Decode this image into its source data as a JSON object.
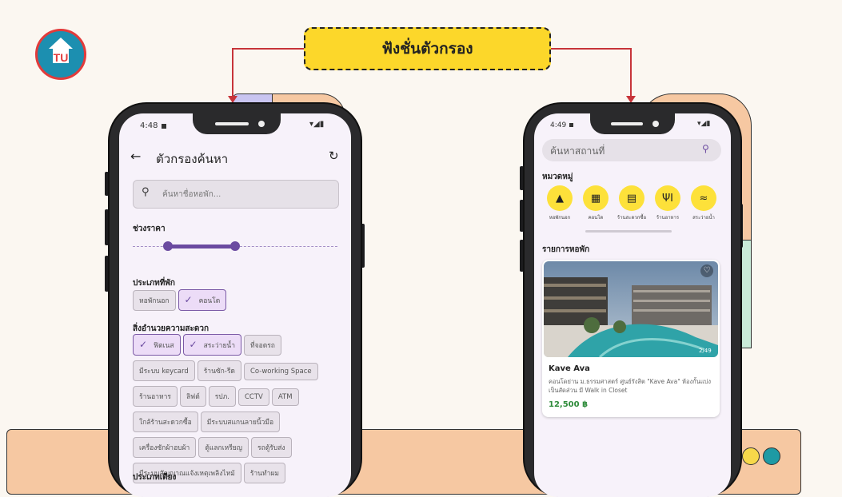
{
  "banner": {
    "title": "ฟังชั่นตัวกรอง"
  },
  "left_phone": {
    "status_time": "4:48",
    "header_title": "ตัวกรองค้นหา",
    "search_placeholder": "ค้นหาชื่อหอพัก...",
    "price_section": "ช่วงราคา",
    "type_section": "ประเภทที่พัก",
    "type_chips": [
      {
        "label": "หอพักนอก",
        "selected": false
      },
      {
        "label": "คอนโด",
        "selected": true
      }
    ],
    "amenity_section": "สิ่งอำนวยความสะดวก",
    "amenity_rows": [
      [
        {
          "label": "ฟิตเนส",
          "selected": true
        },
        {
          "label": "สระว่ายน้ำ",
          "selected": true
        },
        {
          "label": "ที่จอดรถ",
          "selected": false
        }
      ],
      [
        {
          "label": "มีระบบ keycard",
          "selected": false
        },
        {
          "label": "ร้านซัก-รีด",
          "selected": false
        },
        {
          "label": "Co-working Space",
          "selected": false
        }
      ],
      [
        {
          "label": "ร้านอาหาร",
          "selected": false
        },
        {
          "label": "ลิฟต์",
          "selected": false
        },
        {
          "label": "รปภ.",
          "selected": false
        },
        {
          "label": "CCTV",
          "selected": false
        },
        {
          "label": "ATM",
          "selected": false
        }
      ],
      [
        {
          "label": "ใกล้ร้านสะดวกซื้อ",
          "selected": false
        },
        {
          "label": "มีระบบสแกนลายนิ้วมือ",
          "selected": false
        }
      ],
      [
        {
          "label": "เครื่องซักผ้าอบผ้า",
          "selected": false
        },
        {
          "label": "ตู้แลกเหรียญ",
          "selected": false
        },
        {
          "label": "รถตู้รับส่ง",
          "selected": false
        }
      ],
      [
        {
          "label": "มีระบบสัญญาณแจ้งเหตุเพลิงไหม้",
          "selected": false
        },
        {
          "label": "ร้านทำผม",
          "selected": false
        }
      ]
    ],
    "bed_section": "ประเภทเตียง"
  },
  "right_phone": {
    "status_time": "4:49",
    "search_placeholder": "ค้นหาสถานที่",
    "category_section": "หมวดหมู่",
    "categories": [
      {
        "label": "หอพักนอก",
        "icon": "mountain-icon",
        "glyph": "▲"
      },
      {
        "label": "คอนโด",
        "icon": "building-icon",
        "glyph": "▦"
      },
      {
        "label": "ร้านสะดวกซื้อ",
        "icon": "store-icon",
        "glyph": "▤"
      },
      {
        "label": "ร้านอาหาร",
        "icon": "restaurant-icon",
        "glyph": "ΨΙ"
      },
      {
        "label": "สระว่ายน้ำ",
        "icon": "pool-icon",
        "glyph": "≈"
      }
    ],
    "list_section": "รายการหอพัก",
    "listing": {
      "photo_count": "2/49",
      "name": "Kave Ava",
      "description": "คอนโดย่าน ม.ธรรมศาสตร์ ศูนย์รังสิต \"Kave Ava\" ห้องกั้นแบ่งเป็นสัดส่วน มี Walk in Closet",
      "price": "12,500 ฿"
    }
  },
  "colors": {
    "accent": "#6b4ba0",
    "banner": "#fcd72a",
    "connector": "#c7343a",
    "price": "#2e8b3a"
  }
}
